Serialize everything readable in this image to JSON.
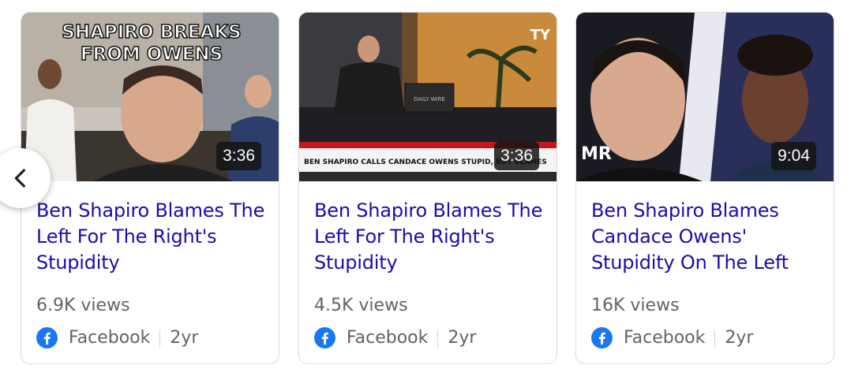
{
  "cards": [
    {
      "thumb_banner": "SHAPIRO BREAKS FROM OWENS",
      "duration": "3:36",
      "title": "Ben Shapiro Blames The Left For The Right's Stupidity",
      "views": "6.9K views",
      "source": "Facebook",
      "age": "2yr"
    },
    {
      "thumb_ticker": "BEN SHAPIRO CALLS CANDACE OWENS STUPID, BUT BLAMES",
      "thumb_monitor": "DAILY WIRE",
      "thumb_corner": "TY",
      "duration": "3:36",
      "title": "Ben Shapiro Blames The Left For The Right's Stupidity",
      "views": "4.5K views",
      "source": "Facebook",
      "age": "2yr"
    },
    {
      "thumb_corner": "MR",
      "duration": "9:04",
      "title": "Ben Shapiro Blames Candace Owens' Stupidity On The Left",
      "views": "16K views",
      "source": "Facebook",
      "age": "2yr"
    }
  ],
  "nav": {
    "prev_icon": "chevron-left-icon"
  },
  "colors": {
    "title": "#1a0dab",
    "meta": "#5f6368",
    "facebook": "#1877f2",
    "border": "#dadce0"
  }
}
